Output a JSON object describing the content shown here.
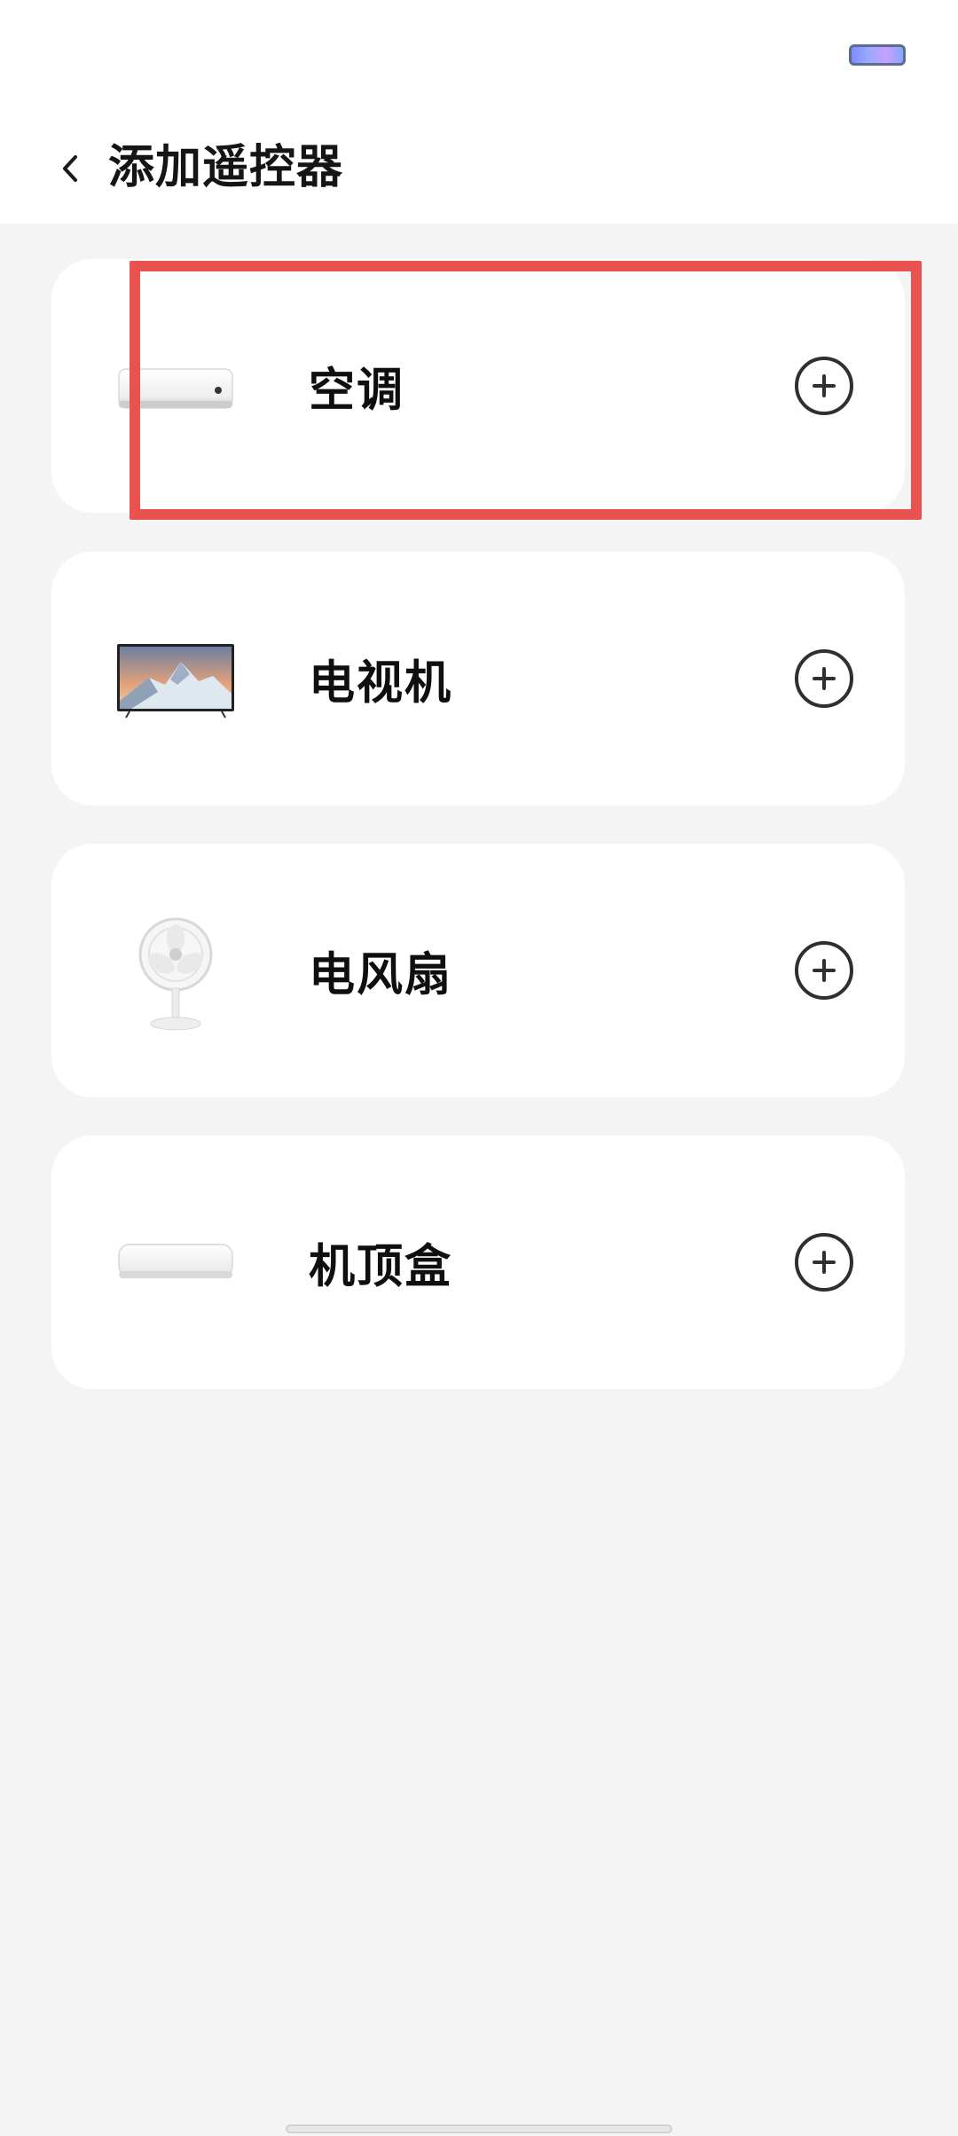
{
  "header": {
    "title": "添加遥控器"
  },
  "devices": [
    {
      "label": "空调",
      "icon": "air-conditioner-icon"
    },
    {
      "label": "电视机",
      "icon": "tv-icon"
    },
    {
      "label": "电风扇",
      "icon": "fan-icon"
    },
    {
      "label": "机顶盒",
      "icon": "set-top-box-icon"
    }
  ],
  "colors": {
    "highlight": "#e9524f",
    "background": "#f4f4f4",
    "card": "#ffffff"
  }
}
